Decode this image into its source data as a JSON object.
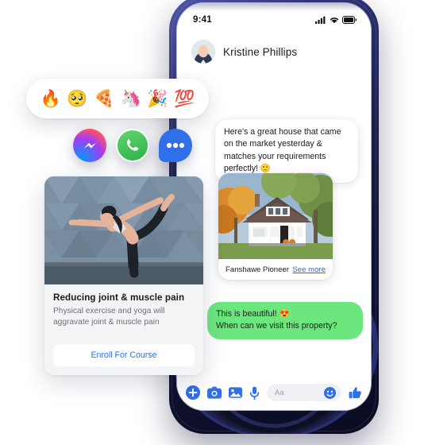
{
  "phone": {
    "status": {
      "time": "9:41",
      "signal_icon": "cellular-signal-icon",
      "wifi_icon": "wifi-icon",
      "battery_icon": "battery-icon"
    },
    "header": {
      "contact_name": "Kristine Phillips",
      "avatar_icon": "contact-avatar"
    },
    "messages": {
      "incoming_text": "Here's a great house that came on the market yesterday & matches your requirements perfectly! 🙂",
      "outgoing_line1": "This is beautiful! 😍",
      "outgoing_line2": "When can we visit this property?",
      "outgoing_bg": "#6de67e"
    },
    "property_card": {
      "title": "Fanshawe Pioneer",
      "link_label": "See more",
      "link_color": "#1f6fe0",
      "photo_alt": "white-bungalow-house-photo"
    },
    "composer": {
      "placeholder": "Aa",
      "icons": [
        "plus-icon",
        "camera-icon",
        "gallery-icon",
        "microphone-icon",
        "emoji-smiley-icon",
        "thumbs-up-icon"
      ],
      "accent": "#2f6fe8"
    }
  },
  "emoji_bar": {
    "emojis": [
      "🔥",
      "🥺",
      "🍕",
      "🦄",
      "🎉",
      "💯"
    ],
    "names": [
      "fire-emoji",
      "pleading-face-emoji",
      "pizza-emoji",
      "unicorn-emoji",
      "party-popper-emoji",
      "hundred-points-emoji"
    ]
  },
  "app_icons": [
    {
      "name": "messenger-app-icon",
      "label": "Messenger"
    },
    {
      "name": "whatsapp-app-icon",
      "label": "WhatsApp"
    },
    {
      "name": "sms-app-icon",
      "label": "SMS"
    }
  ],
  "course_card": {
    "title": "Reducing joint & muscle pain",
    "description": "Physical exercise and yoga will aggravate joint & muscle pain",
    "button_label": "Enroll For Course",
    "button_color": "#2f6fe8",
    "photo_alt": "woman-yoga-dancer-pose-photo"
  }
}
